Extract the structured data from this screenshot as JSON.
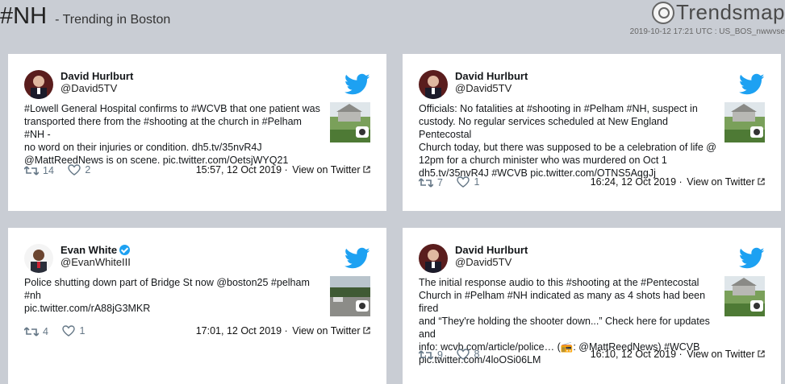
{
  "header": {
    "hashtag": "#NH",
    "subtitle": "- Trending in Boston",
    "brand": "Trendsmap",
    "meta": "2019-10-12 17:21 UTC : US_BOS_nwwvse"
  },
  "icons": {
    "retweet": "retweet-icon",
    "like": "heart-icon",
    "bird": "twitter-bird-icon",
    "camera": "camera-icon",
    "external": "external-link-icon"
  },
  "colors": {
    "twitter_blue": "#1da1f2",
    "background": "#c9cdd4"
  },
  "tweets": [
    {
      "name": "David Hurlburt",
      "handle": "@David5TV",
      "lines": [
        "#Lowell General Hospital confirms to #WCVB that one patient was",
        "transported there from the #shooting at the church in #Pelham #NH -",
        "no word on their injuries or condition. dh5.tv/35nvR4J",
        "@MattReedNews is on scene. pic.twitter.com/OetsjWYQ21"
      ],
      "retweets": "14",
      "likes": "2",
      "time": "15:57, 12 Oct 2019",
      "sep": "·",
      "view": "View on Twitter"
    },
    {
      "name": "David Hurlburt",
      "handle": "@David5TV",
      "lines": [
        "Officials: No fatalities at #shooting in #Pelham #NH, suspect in",
        "custody. No regular services scheduled at New England Pentecostal",
        "Church today, but there was supposed to be a celebration of life @",
        "12pm for a church minister who was murdered on Oct 1",
        "dh5.tv/35nvR4J #WCVB pic.twitter.com/OTNS5AqgJj"
      ],
      "retweets": "7",
      "likes": "1",
      "time": "16:24, 12 Oct 2019",
      "sep": "·",
      "view": "View on Twitter"
    },
    {
      "name": "Evan White",
      "handle": "@EvanWhiteIII",
      "lines": [
        "Police shutting down part of Bridge St now @boston25 #pelham #nh",
        "pic.twitter.com/rA88jG3MKR"
      ],
      "retweets": "4",
      "likes": "1",
      "time": "17:01, 12 Oct 2019",
      "sep": "·",
      "view": "View on Twitter"
    },
    {
      "name": "David Hurlburt",
      "handle": "@David5TV",
      "lines": [
        "The initial response audio to this #shooting at the #Pentecostal",
        "Church in #Pelham #NH indicated as many as 4 shots had been fired",
        "and “They're holding the shooter down...” Check here for updates and",
        "info: wcvb.com/article/police… (📻: @MattReedNews) #WCVB",
        "pic.twitter.com/4loOSi06LM"
      ],
      "retweets": "9",
      "likes": "8",
      "time": "16:10, 12 Oct 2019",
      "sep": "·",
      "view": "View on Twitter"
    }
  ]
}
